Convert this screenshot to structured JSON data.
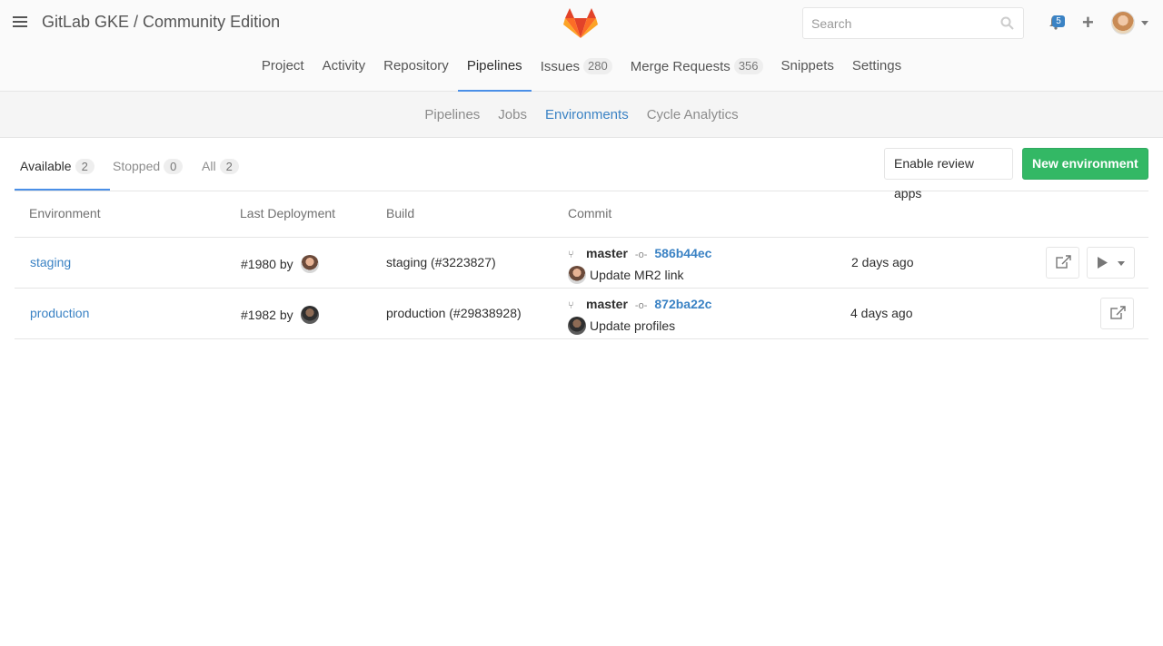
{
  "header": {
    "title": "GitLab GKE / Community Edition",
    "search_placeholder": "Search",
    "notifications_count": "5"
  },
  "nav": {
    "items": [
      {
        "label": "Project"
      },
      {
        "label": "Activity"
      },
      {
        "label": "Repository"
      },
      {
        "label": "Pipelines",
        "active": true
      },
      {
        "label": "Issues",
        "count": "280"
      },
      {
        "label": "Merge Requests",
        "count": "356"
      },
      {
        "label": "Snippets"
      },
      {
        "label": "Settings"
      }
    ]
  },
  "subnav": {
    "items": [
      {
        "label": "Pipelines"
      },
      {
        "label": "Jobs"
      },
      {
        "label": "Environments",
        "active": true
      },
      {
        "label": "Cycle Analytics"
      }
    ]
  },
  "tabs": {
    "available": {
      "label": "Available",
      "count": "2"
    },
    "stopped": {
      "label": "Stopped",
      "count": "0"
    },
    "all": {
      "label": "All",
      "count": "2"
    }
  },
  "buttons": {
    "review_apps": "Enable review apps",
    "new_environment": "New environment"
  },
  "table": {
    "headers": {
      "environment": "Environment",
      "last_deployment": "Last Deployment",
      "build": "Build",
      "commit": "Commit"
    },
    "rows": [
      {
        "name": "staging",
        "deployment": "#1980",
        "by": "by",
        "build": "staging (#3223827)",
        "branch": "master",
        "sha": "586b44ec",
        "message": "Update MR2 link",
        "time": "2 days ago"
      },
      {
        "name": "production",
        "deployment": "#1982",
        "by": "by",
        "build": "production (#29838928)",
        "branch": "master",
        "sha": "872ba22c",
        "message": "Update profiles",
        "time": "4 days ago"
      }
    ]
  },
  "colors": {
    "accent": "#3a82c4",
    "success": "#33b865",
    "active_tab": "#4a8fe7"
  }
}
